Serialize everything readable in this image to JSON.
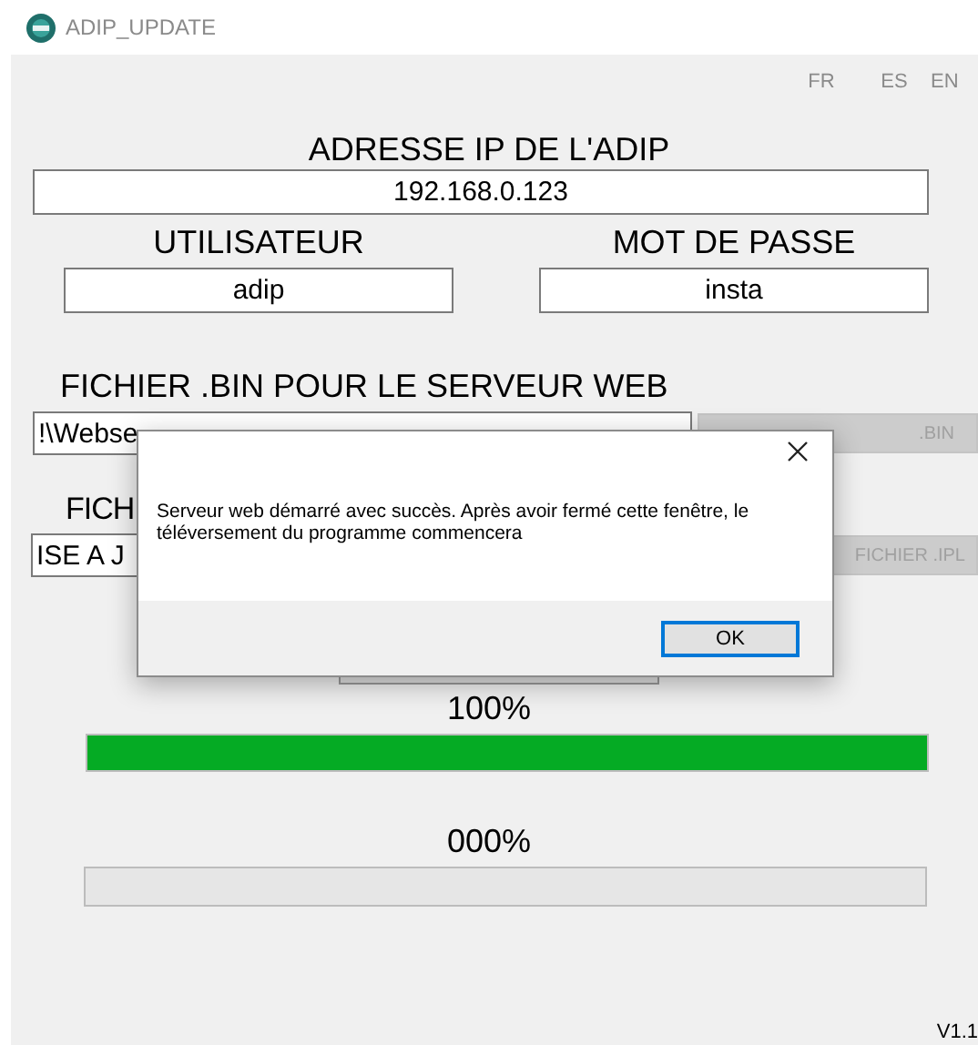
{
  "window": {
    "title": "ADIP_UPDATE"
  },
  "languages": [
    {
      "label": "FR"
    },
    {
      "label": "ES"
    },
    {
      "label": "EN"
    }
  ],
  "ip": {
    "label": "ADRESSE IP DE L'ADIP",
    "value": "192.168.0.123"
  },
  "credentials": [
    {
      "label": "UTILISATEUR",
      "value": "adip"
    },
    {
      "label": "MOT DE PASSE",
      "value": "insta"
    }
  ],
  "bin_file": {
    "label": "FICHIER .BIN POUR LE SERVEUR WEB",
    "value": "!\\Webse",
    "button": ".BIN",
    "disabled": true
  },
  "ipl_file": {
    "label": "FICH",
    "value": "ISE A J",
    "button": "FICHIER .IPL",
    "disabled": true
  },
  "progress": [
    {
      "reading": "100%",
      "level": 1
    },
    {
      "reading": "000%",
      "level": 0
    }
  ],
  "version": "V1.1",
  "dialog": {
    "message": "Serveur web démarré avec succès. Après avoir fermé cette fenêtre, le téléversement du programme commencera",
    "button": "OK"
  }
}
